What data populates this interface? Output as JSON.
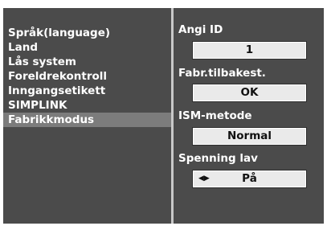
{
  "menu": {
    "items": [
      {
        "label": "Språk(language)"
      },
      {
        "label": "Land"
      },
      {
        "label": "Lås system"
      },
      {
        "label": "Foreldrekontroll"
      },
      {
        "label": "Inngangsetikett"
      },
      {
        "label": "SIMPLINK"
      },
      {
        "label": "Fabrikkmodus",
        "selected": true
      }
    ]
  },
  "settings": {
    "angi_id": {
      "label": "Angi ID",
      "value": "1"
    },
    "factory_reset": {
      "label": "Fabr.tilbakest.",
      "value": "OK"
    },
    "ism_method": {
      "label": "ISM-metode",
      "value": "Normal"
    },
    "low_voltage": {
      "label": "Spenning lav",
      "value": "På",
      "arrows": "◀▶"
    }
  },
  "colors": {
    "background": "#4b4b4b",
    "selected_item": "#7c7c7c",
    "divider": "#c8c8c8",
    "value_box": "#eaeaea",
    "text": "#ffffff"
  }
}
